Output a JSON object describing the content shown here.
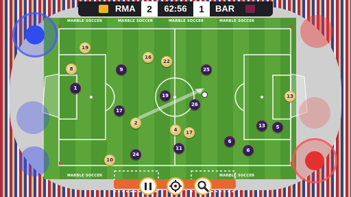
{
  "scoreboard": {
    "home_team": "RMA",
    "home_score": "2",
    "clock": "62:56",
    "away_score": "1",
    "away_team": "BAR",
    "home_color": "#f2b31c",
    "away_color": "#7a1f4a"
  },
  "ad_text": "MARBLE SOCCER",
  "players": {
    "home": [
      "19",
      "8",
      "16",
      "22",
      "2",
      "4",
      "17",
      "10",
      "13"
    ],
    "away": [
      "9",
      "1",
      "25",
      "19",
      "26",
      "17",
      "24",
      "11",
      "6",
      "13",
      "5",
      "6"
    ]
  },
  "controls": {
    "pause_icon": "pause-icon",
    "camera_icon": "target-icon",
    "zoom_icon": "magnifier-icon",
    "left_stick_color": "#2f4cf0",
    "right_stick_color": "#f03a3a"
  }
}
